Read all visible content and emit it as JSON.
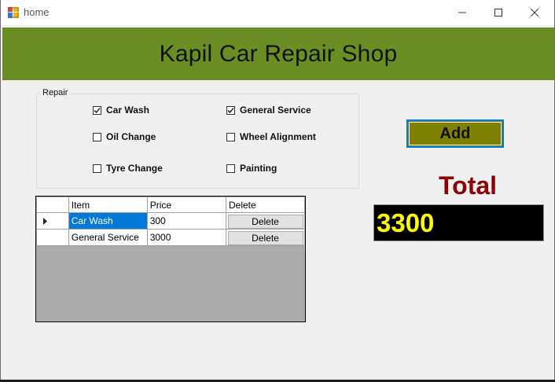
{
  "window": {
    "title": "home"
  },
  "banner": {
    "title": "Kapil Car Repair Shop",
    "color": "#6b8e23"
  },
  "repair_group": {
    "legend": "Repair",
    "options": [
      {
        "label": "Car Wash",
        "checked": true
      },
      {
        "label": "General Service",
        "checked": true
      },
      {
        "label": "Oil Change",
        "checked": false
      },
      {
        "label": "Wheel Alignment",
        "checked": false
      },
      {
        "label": "Tyre Change",
        "checked": false
      },
      {
        "label": "Painting",
        "checked": false
      }
    ]
  },
  "add_button": {
    "label": "Add",
    "color": "#808000"
  },
  "total": {
    "label": "Total",
    "value": "3300",
    "label_color": "#8b0000",
    "value_color": "#ffff00"
  },
  "grid": {
    "columns": [
      "Item",
      "Price",
      "Delete"
    ],
    "rows": [
      {
        "item": "Car Wash",
        "price": "300",
        "delete": "Delete",
        "selected": true
      },
      {
        "item": "General Service",
        "price": "3000",
        "delete": "Delete",
        "selected": false
      }
    ]
  }
}
